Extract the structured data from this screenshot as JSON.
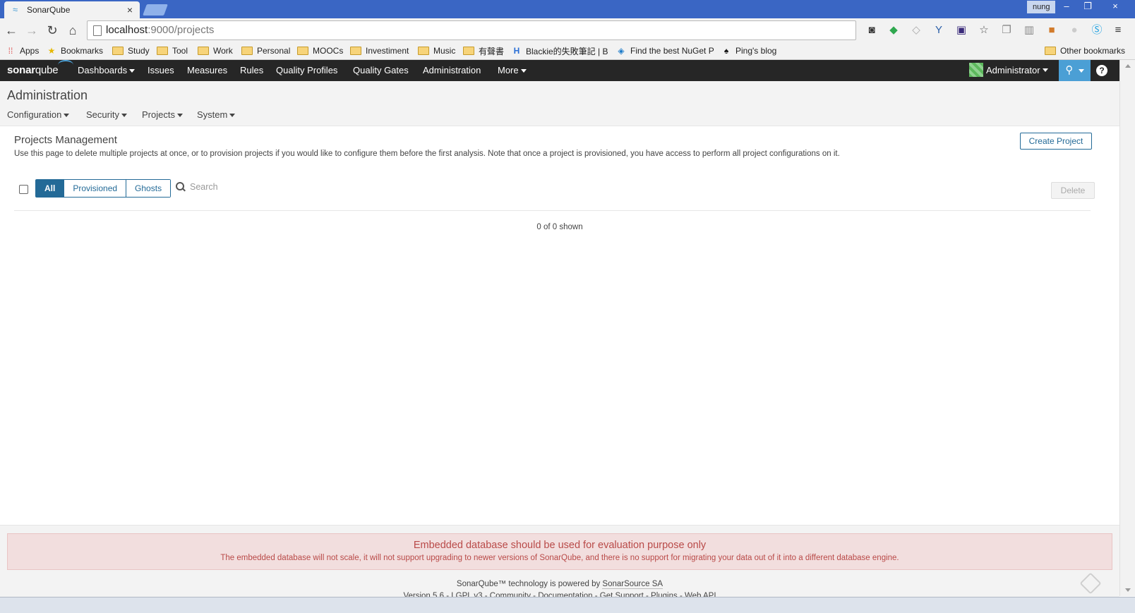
{
  "browser": {
    "tab_title": "SonarQube",
    "tab_close": "×",
    "window_user": "nung",
    "window_buttons": {
      "minimize": "–",
      "restore": "❐",
      "close": "×"
    },
    "url_host": "localhost",
    "url_path": ":9000/projects",
    "bookmarks": {
      "apps": "Apps",
      "items": [
        "Bookmarks",
        "Study",
        "Tool",
        "Work",
        "Personal",
        "MOOCs",
        "Investiment",
        "Music",
        "有聲書",
        "Blackie的失敗筆記 | B",
        "Find the best NuGet P",
        "Ping's blog"
      ],
      "other": "Other bookmarks"
    }
  },
  "nav": {
    "logo_bold": "sonar",
    "logo_light": "qube",
    "items": [
      "Dashboards",
      "Issues",
      "Measures",
      "Rules",
      "Quality Profiles",
      "Quality Gates",
      "Administration",
      "More"
    ],
    "user": "Administrator",
    "help": "?"
  },
  "header": {
    "title": "Administration",
    "menus": [
      "Configuration",
      "Security",
      "Projects",
      "System"
    ]
  },
  "main": {
    "title": "Projects Management",
    "description": "Use this page to delete multiple projects at once, or to provision projects if you would like to configure them before the first analysis. Note that once a project is provisioned, you have access to perform all project configurations on it.",
    "create_button": "Create Project",
    "filters": [
      "All",
      "Provisioned",
      "Ghosts"
    ],
    "active_filter": "All",
    "search_placeholder": "Search",
    "delete_button": "Delete",
    "shown": "0 of 0 shown"
  },
  "footer": {
    "alert_title": "Embedded database should be used for evaluation purpose only",
    "alert_text": "The embedded database will not scale, it will not support upgrading to newer versions of SonarQube, and there is no support for migrating your data out of it into a different database engine.",
    "powered_prefix": "SonarQube™ technology is powered by ",
    "powered_link": "SonarSource SA",
    "version": "Version 5.6",
    "links": [
      "LGPL v3",
      "Community",
      "Documentation",
      "Get Support",
      "Plugins",
      "Web API"
    ]
  },
  "colors": {
    "nav_bg": "#262626",
    "accent": "#236a97",
    "search_accent": "#4b9fd5",
    "alert_bg": "#f2dede",
    "alert_text": "#b94a48"
  }
}
